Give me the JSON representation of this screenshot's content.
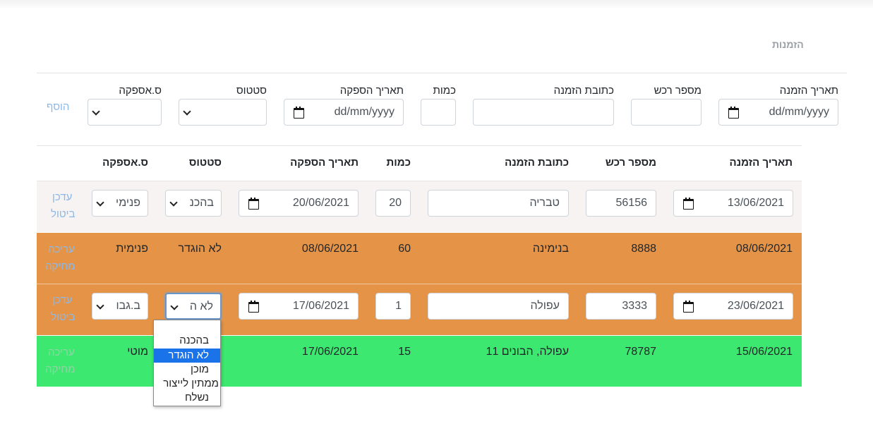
{
  "nav": {
    "title": "הזמנות"
  },
  "form": {
    "labels": {
      "order_date": "תאריך הזמנה",
      "vehicle_number": "מספר רכש",
      "order_address": "כתובת הזמנה",
      "quantity": "כמות",
      "supply_date": "תאריך הספקה",
      "status": "סטטוס",
      "supplier": "ס.אספקה"
    },
    "order_date_placeholder": "dd/mm/yyyy",
    "supply_date_placeholder": "dd/mm/yyyy",
    "add_label": "הוסף"
  },
  "table": {
    "headers": {
      "order_date": "תאריך הזמנה",
      "vehicle_number": "מספר רכש",
      "order_address": "כתובת הזמנה",
      "quantity": "כמות",
      "supply_date": "תאריך הספקה",
      "status": "סטטוס",
      "supplier": "ס.אספקה"
    },
    "rows": [
      {
        "mode": "edit",
        "order_date": "13/06/2021",
        "vehicle_number": "56156",
        "order_address": "טבריה",
        "quantity": "20",
        "supply_date": "20/06/2021",
        "status": "בהכנ",
        "supplier": "פנימי",
        "action1": "עדכן",
        "action2": "ביטול"
      },
      {
        "mode": "view",
        "color": "#e59447",
        "order_date": "08/06/2021",
        "vehicle_number": "8888",
        "order_address": "בנימינה",
        "quantity": "60",
        "supply_date": "08/06/2021",
        "status": "לא הוגדר",
        "supplier": "פנימית",
        "action1": "עריכה",
        "action2": "מחיקה"
      },
      {
        "mode": "edit",
        "color": "#e59447",
        "order_date": "23/06/2021",
        "vehicle_number": "3333",
        "order_address": "עפולה",
        "quantity": "1",
        "supply_date": "17/06/2021",
        "status": "לא ה",
        "supplier": "ב.גבו",
        "action1": "עדכן",
        "action2": "ביטול"
      },
      {
        "mode": "view",
        "color": "#3ce870",
        "order_date": "15/06/2021",
        "vehicle_number": "78787",
        "order_address": "עפולה, הבונים 11",
        "quantity": "15",
        "supply_date": "17/06/2021",
        "status": "",
        "supplier": "מוטי",
        "action1": "עריכה",
        "action2": "מחיקה"
      }
    ]
  },
  "status_dropdown": {
    "options": [
      "בהכנה",
      "לא הוגדר",
      "מוכן",
      "ממתין לייצור",
      "נשלח"
    ],
    "selected": "לא הוגדר"
  }
}
